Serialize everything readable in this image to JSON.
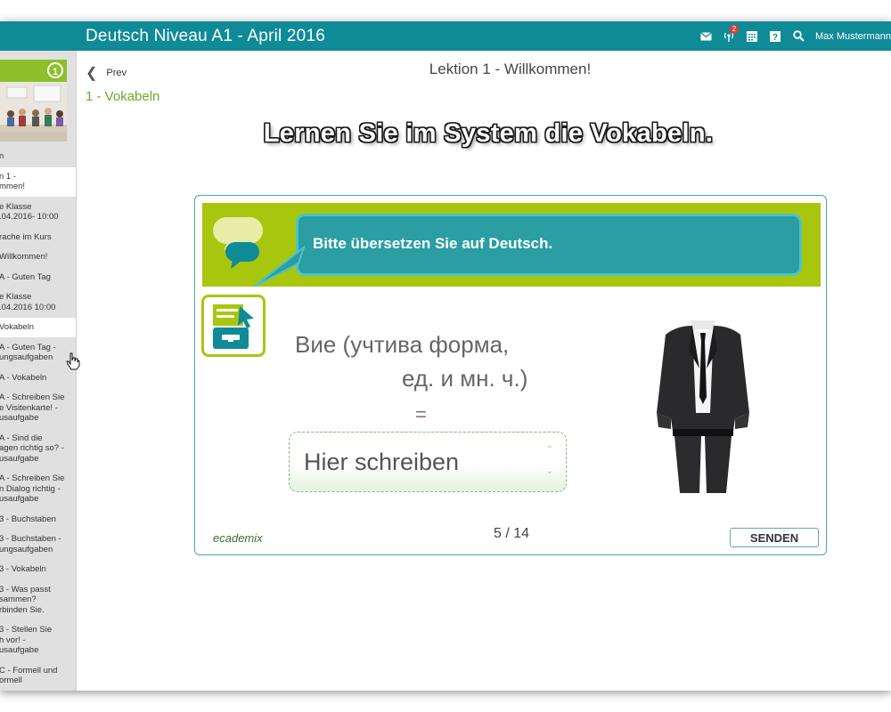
{
  "app": {
    "title": "Deutsch Niveau A1 - April 2016",
    "user_name": "Max Mustermann",
    "notification_count": "2"
  },
  "icons": {
    "mail": "mail-icon",
    "notifications": "broadcast-icon",
    "calendar": "calendar-icon",
    "help": "help-icon",
    "search": "search-icon"
  },
  "sidebar": {
    "course_badge": "1",
    "items": [
      {
        "label": "n"
      },
      {
        "label": "n 1 -\nmmen!",
        "active": true
      },
      {
        "label": "e Klasse\n.04.2016- 10:00"
      },
      {
        "label": "rache im Kurs"
      },
      {
        "label": "Willkommen!"
      },
      {
        "label": "A - Guten Tag"
      },
      {
        "label": "e Klasse\n.04.2016 10:00"
      },
      {
        "label": "Vokabeln",
        "active": true
      },
      {
        "label": "A - Guten Tag -\nungsaufgaben"
      },
      {
        "label": "A - Vokabeln"
      },
      {
        "label": "A - Schreiben Sie\ne Visitenkarte! -\nusaufgabe"
      },
      {
        "label": "A - Sind die\nagen richtig so? -\nusaufgabe"
      },
      {
        "label": "A - Schreiben Sie\nn Dialog richtig -\nusaufgabe"
      },
      {
        "label": "3 - Buchstaben"
      },
      {
        "label": "3 - Buchstaben -\nungsaufgaben"
      },
      {
        "label": "3 - Vokabeln"
      },
      {
        "label": "3 - Was passt\nsammen?\nrbinden Sie."
      },
      {
        "label": "3 - Stellen Sie\nh vor! -\nusaufgabe"
      },
      {
        "label": "C - Formell und\normell"
      }
    ]
  },
  "nav": {
    "prev_label": "Prev",
    "lesson_title": "Lektion 1 - Willkommen!",
    "section_label": "1 - Vokabeln"
  },
  "main": {
    "headline": "Lernen Sie im System die Vokabeln."
  },
  "exercise": {
    "instruction": "Bitte übersetzen Sie auf Deutsch.",
    "prompt_line1": "Вие (учтива форма,",
    "prompt_line2": "ед. и мн. ч.)",
    "equals": "=",
    "answer_placeholder": "Hier schreiben",
    "progress": "5 / 14",
    "send_label": "SENDEN",
    "logo_text": "ecademix"
  },
  "colors": {
    "topbar": "#0f8b98",
    "banner_green": "#a9c60e",
    "bubble_teal": "#2b9ea3",
    "section_green": "#6aa82c"
  }
}
